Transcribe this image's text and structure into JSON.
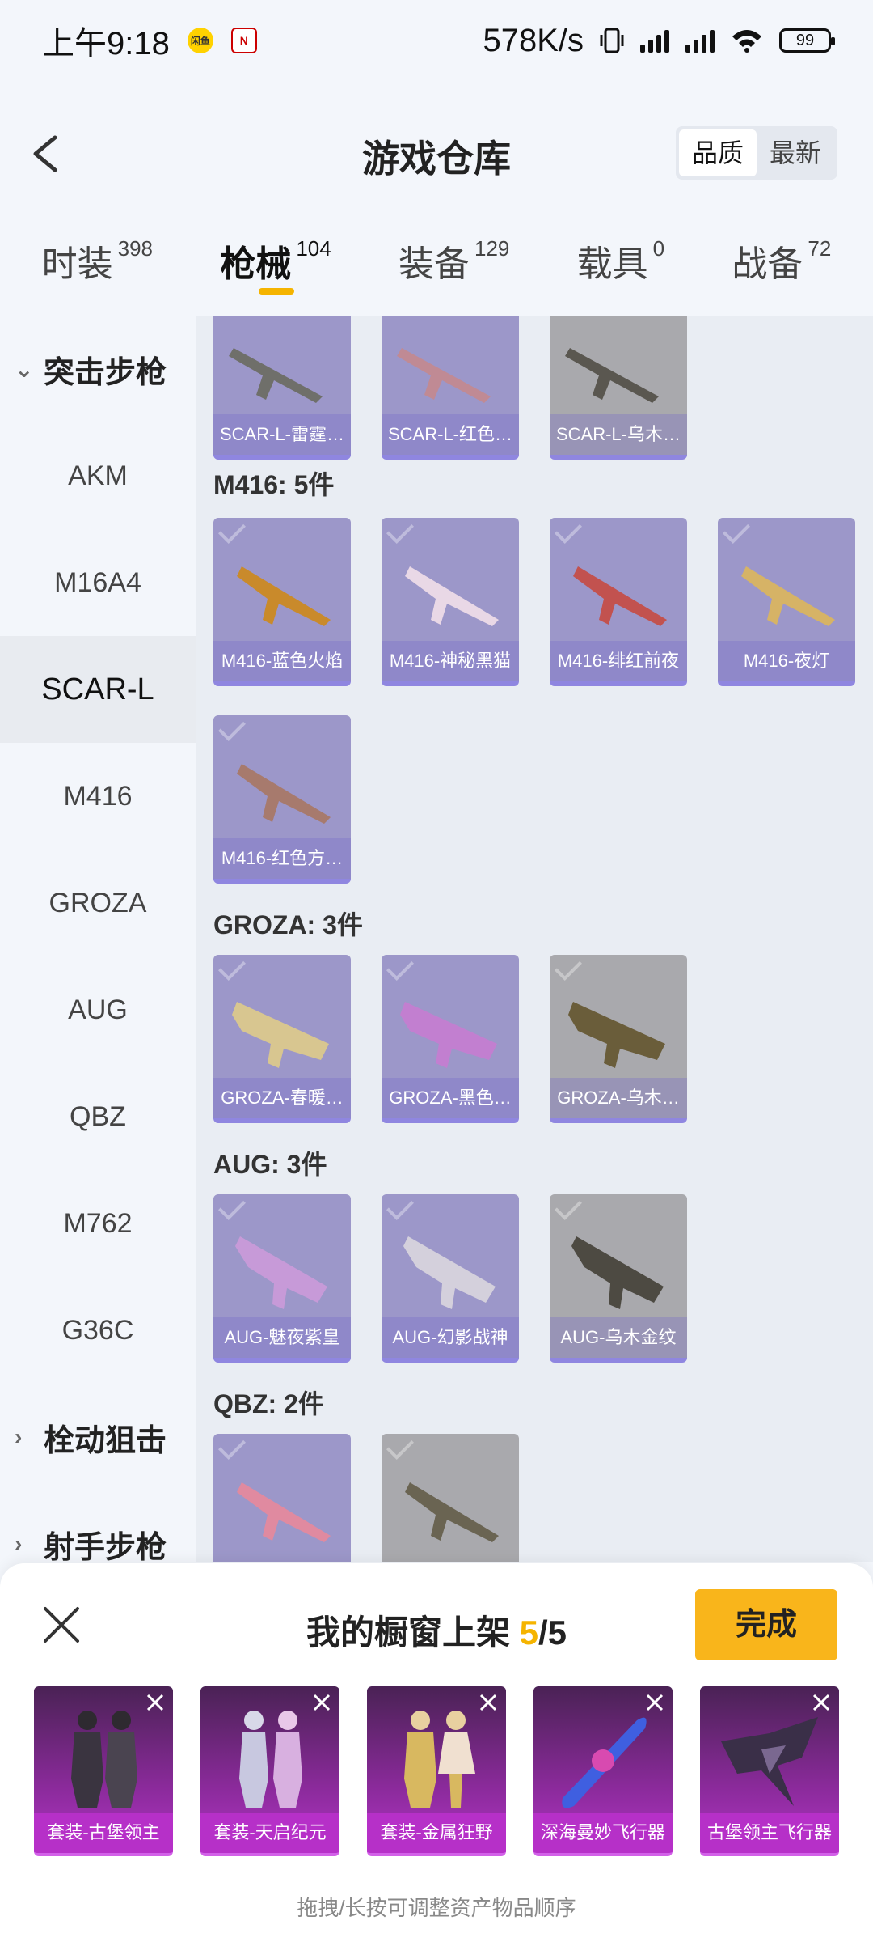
{
  "status_bar": {
    "time": "上午9:18",
    "badge1": "闲鱼",
    "badge2": "N",
    "net_speed": "578K/s",
    "battery": "99"
  },
  "header": {
    "title": "游戏仓库",
    "sort_options": [
      "品质",
      "最新"
    ]
  },
  "tabs": [
    {
      "name": "时装",
      "count": "398"
    },
    {
      "name": "枪械",
      "count": "104"
    },
    {
      "name": "装备",
      "count": "129"
    },
    {
      "name": "载具",
      "count": "0"
    },
    {
      "name": "战备",
      "count": "72"
    }
  ],
  "sidebar": {
    "group_assault": "突击步枪",
    "items": [
      "AKM",
      "M16A4",
      "SCAR-L",
      "M416",
      "GROZA",
      "AUG",
      "QBZ",
      "M762",
      "G36C"
    ],
    "group_bolt": "栓动狙击",
    "group_marksman": "射手步枪"
  },
  "content": {
    "scar_cards": [
      "SCAR-L-雷霆…",
      "SCAR-L-红色…",
      "SCAR-L-乌木…"
    ],
    "m416_title": "M416: 5件",
    "m416_cards": [
      "M416-蓝色火焰",
      "M416-神秘黑猫",
      "M416-绯红前夜",
      "M416-夜灯",
      "M416-红色方…"
    ],
    "groza_title": "GROZA: 3件",
    "groza_cards": [
      "GROZA-春暖…",
      "GROZA-黑色…",
      "GROZA-乌木…"
    ],
    "aug_title": "AUG: 3件",
    "aug_cards": [
      "AUG-魅夜紫皇",
      "AUG-幻影战神",
      "AUG-乌木金纹"
    ],
    "qbz_title": "QBZ: 2件"
  },
  "panel": {
    "title_prefix": "我的橱窗上架 ",
    "current": "5",
    "total": "/5",
    "done": "完成",
    "slots": [
      "套装-古堡领主",
      "套装-天启纪元",
      "套装-金属狂野",
      "深海曼妙飞行器",
      "古堡领主飞行器"
    ],
    "hint": "拖拽/长按可调整资产物品顺序"
  },
  "colors": {
    "accent": "#f5b400",
    "done_button": "#f9b51b",
    "card_purple": "#9c97c9",
    "slot_magenta": "#b630c8"
  }
}
